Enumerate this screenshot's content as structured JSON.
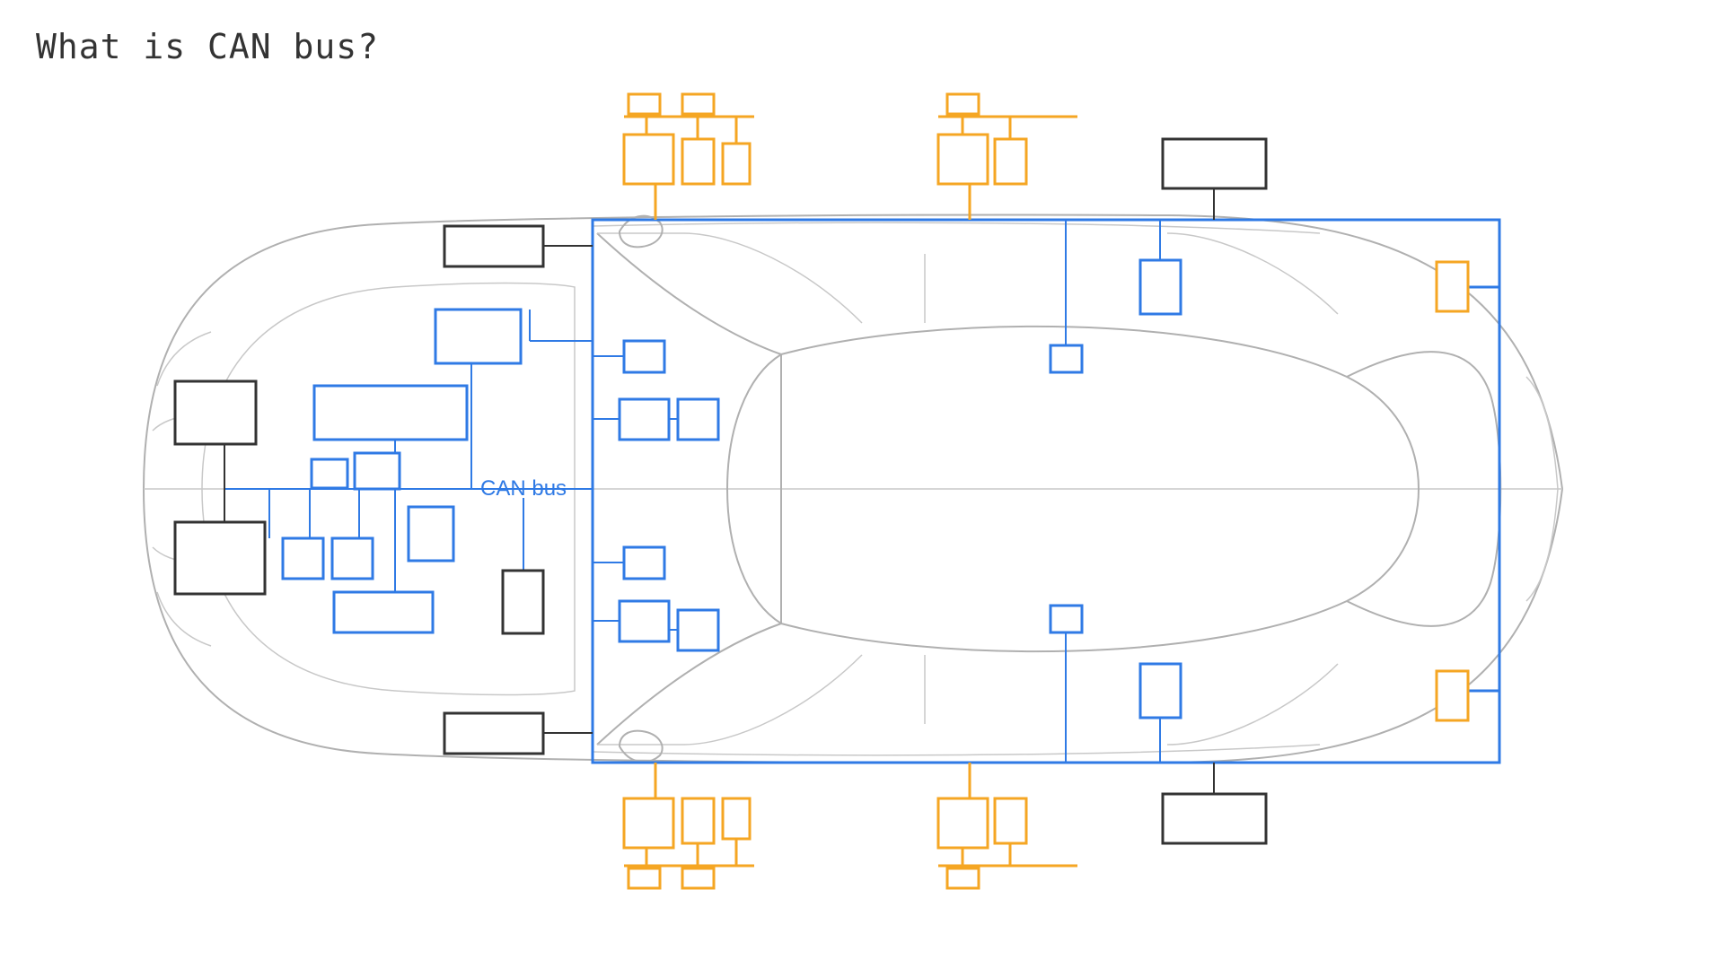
{
  "title": "What is CAN bus?",
  "diagram": {
    "bus_label": "CAN bus",
    "colors": {
      "bus": "#2f7ae5",
      "ecu_primary": "#2f7ae5",
      "ecu_secondary": "#333333",
      "ecu_orange": "#f5a623",
      "car_outline": "#b0b0b0"
    }
  }
}
